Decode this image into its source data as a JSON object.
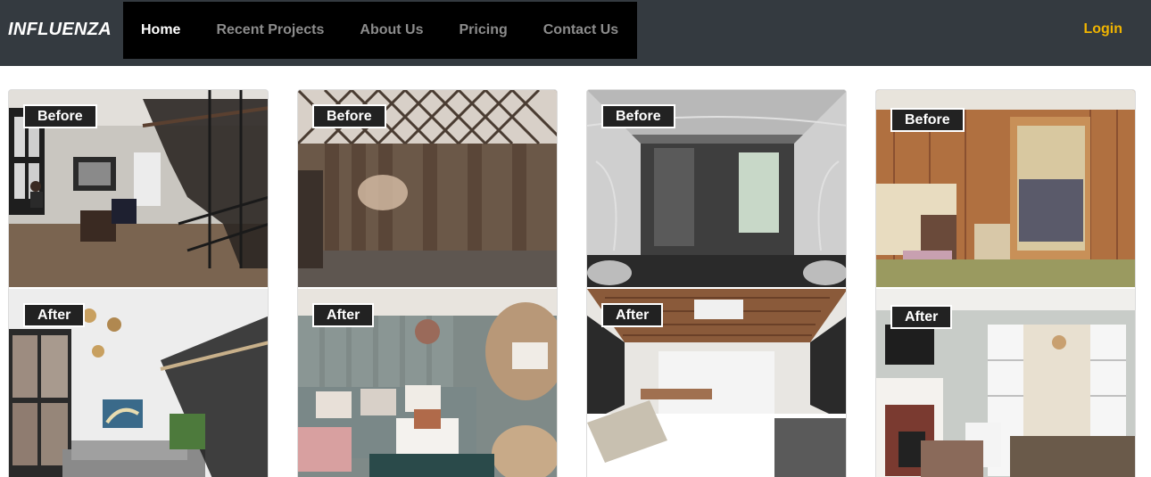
{
  "brand": {
    "name": "INFLUENZA"
  },
  "nav": {
    "items": [
      {
        "label": "Home",
        "active": true
      },
      {
        "label": "Recent Projects",
        "active": false
      },
      {
        "label": "About Us",
        "active": false
      },
      {
        "label": "Pricing",
        "active": false
      },
      {
        "label": "Contact Us",
        "active": false
      }
    ],
    "login_label": "Login"
  },
  "colors": {
    "navbar": "#343a40",
    "menu": "#000000",
    "accent": "#f0b400",
    "tag_bg": "#222222"
  },
  "projects": [
    {
      "before_label": "Before",
      "after_label": "After"
    },
    {
      "before_label": "Before",
      "after_label": "After"
    },
    {
      "before_label": "Before",
      "after_label": "After"
    },
    {
      "before_label": "Before",
      "after_label": "After"
    }
  ]
}
